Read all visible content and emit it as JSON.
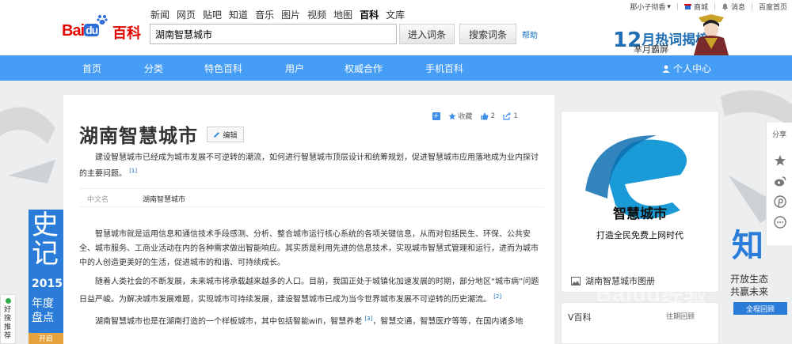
{
  "header": {
    "logo_text": "Bai",
    "logo_du": "du",
    "logo_baike": "百科",
    "top_nav": [
      {
        "label": "新闻",
        "active": false
      },
      {
        "label": "网页",
        "active": false
      },
      {
        "label": "贴吧",
        "active": false
      },
      {
        "label": "知道",
        "active": false
      },
      {
        "label": "音乐",
        "active": false
      },
      {
        "label": "图片",
        "active": false
      },
      {
        "label": "视频",
        "active": false
      },
      {
        "label": "地图",
        "active": false
      },
      {
        "label": "百科",
        "active": true
      },
      {
        "label": "文库",
        "active": false
      }
    ],
    "search_value": "湖南智慧城市",
    "enter_button": "进入词条",
    "search_button": "搜索词条",
    "help_link": "帮助",
    "user_links": {
      "username": "那小子彻香",
      "mall": "商城",
      "messages": "消息",
      "home": "百度首页"
    },
    "ad": {
      "big_number": "12",
      "title_rest": "月热词揭榜",
      "subtitle": "芈月霸屏"
    }
  },
  "nav": {
    "items": [
      "首页",
      "分类",
      "特色百科",
      "用户",
      "权威合作",
      "手机百科"
    ],
    "user_center": "个人中心"
  },
  "article": {
    "actions": {
      "favorite": "收藏",
      "likes": "2",
      "shares": "1"
    },
    "title": "湖南智慧城市",
    "edit_button": "编辑",
    "summary": "建设智慧城市已经成为城市发展不可逆转的潮流，如何进行智慧城市顶层设计和统筹规划，促进智慧城市应用落地成为业内探讨的主要问题。",
    "summary_ref": "[1]",
    "basic_info": {
      "key": "中文名",
      "value": "湖南智慧城市"
    },
    "paragraphs": [
      {
        "text": "智慧城市就是运用信息和通信技术手段感测、分析、整合城市运行核心系统的各项关键信息，从而对包括民生、环保、公共安全、城市服务、工商业活动在内的各种需求做出智能响应。其实质是利用先进的信息技术，实现城市智慧式管理和运行，进而为城市中的人创造更美好的生活，促进城市的和谐、可持续成长。",
        "ref": ""
      },
      {
        "text": "随着人类社会的不断发展，未来城市将承载越来越多的人口。目前，我国正处于城镇化加速发展的时期，部分地区“城市病”问题日益严峻。为解决城市发展难题，实现城市可持续发展，建设智慧城市已成为当今世界城市发展不可逆转的历史潮流。",
        "ref": "[2]"
      },
      {
        "text": "湖南智慧城市也是在湖南打造的一个样板城市，其中包括智能wifi，智慧养老",
        "ref": "[3]",
        "tail": "，智慧交通，智慧医疗等等，在国内诸多地"
      }
    ]
  },
  "sidebar": {
    "image_title": "智慧城市",
    "image_slogan": "打造全民免费上网时代",
    "caption": "湖南智慧城市图册",
    "vcard_title": "V百科",
    "vcard_more": "往期回顾"
  },
  "share_rail": {
    "label": "分享"
  },
  "right_promo": {
    "zhi": "知",
    "line1": "开放生态",
    "line2": "共赢未来",
    "button": "全程回顾"
  },
  "left_promo": {
    "line1": "史",
    "line2": "记",
    "year": "2015",
    "line3": "年度",
    "line4": "盘点",
    "open": "开启"
  },
  "good_rec": {
    "label": "好搜推荐"
  },
  "watermark": {
    "main": "Baidu经验",
    "sub": "jingyan.baidu.com"
  },
  "colors": {
    "nav_blue": "#459df5",
    "baidu_red": "#e10602",
    "baidu_blue": "#2d6ed6",
    "link_blue": "#136ec2"
  }
}
